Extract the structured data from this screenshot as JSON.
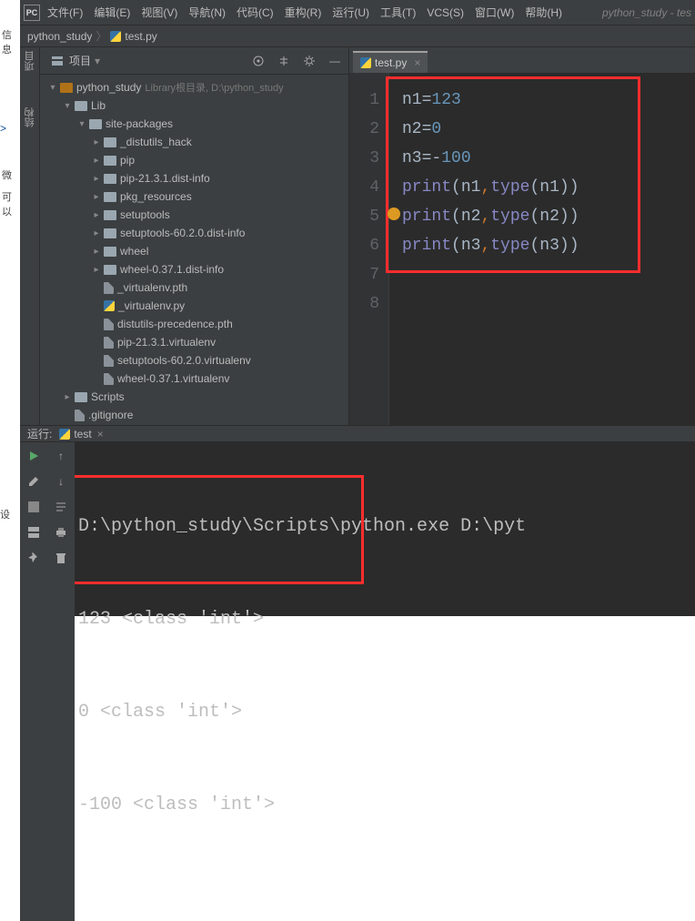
{
  "window": {
    "title_right": "python_study - tes"
  },
  "menu": {
    "logo": "PC",
    "items": [
      "文件(F)",
      "编辑(E)",
      "视图(V)",
      "导航(N)",
      "代码(C)",
      "重构(R)",
      "运行(U)",
      "工具(T)",
      "VCS(S)",
      "窗口(W)",
      "帮助(H)"
    ]
  },
  "crumbs": {
    "root": "python_study",
    "file": "test.py"
  },
  "left_edge": {
    "label1": "项目",
    "label2": "结构"
  },
  "project": {
    "panel_title": "项目",
    "tree": [
      {
        "d": 0,
        "tw": "▾",
        "ico": "dir-root",
        "text": "python_study",
        "hint": "Library根目录, D:\\python_study"
      },
      {
        "d": 1,
        "tw": "▾",
        "ico": "dir",
        "text": "Lib"
      },
      {
        "d": 2,
        "tw": "▾",
        "ico": "dir",
        "text": "site-packages"
      },
      {
        "d": 3,
        "tw": "▸",
        "ico": "dir",
        "text": "_distutils_hack"
      },
      {
        "d": 3,
        "tw": "▸",
        "ico": "dir",
        "text": "pip"
      },
      {
        "d": 3,
        "tw": "▸",
        "ico": "dir",
        "text": "pip-21.3.1.dist-info"
      },
      {
        "d": 3,
        "tw": "▸",
        "ico": "dir",
        "text": "pkg_resources"
      },
      {
        "d": 3,
        "tw": "▸",
        "ico": "dir",
        "text": "setuptools"
      },
      {
        "d": 3,
        "tw": "▸",
        "ico": "dir",
        "text": "setuptools-60.2.0.dist-info"
      },
      {
        "d": 3,
        "tw": "▸",
        "ico": "dir",
        "text": "wheel"
      },
      {
        "d": 3,
        "tw": "▸",
        "ico": "dir",
        "text": "wheel-0.37.1.dist-info"
      },
      {
        "d": 3,
        "tw": "",
        "ico": "file",
        "text": "_virtualenv.pth"
      },
      {
        "d": 3,
        "tw": "",
        "ico": "py",
        "text": "_virtualenv.py"
      },
      {
        "d": 3,
        "tw": "",
        "ico": "file",
        "text": "distutils-precedence.pth"
      },
      {
        "d": 3,
        "tw": "",
        "ico": "file",
        "text": "pip-21.3.1.virtualenv"
      },
      {
        "d": 3,
        "tw": "",
        "ico": "file",
        "text": "setuptools-60.2.0.virtualenv"
      },
      {
        "d": 3,
        "tw": "",
        "ico": "file",
        "text": "wheel-0.37.1.virtualenv"
      },
      {
        "d": 1,
        "tw": "▸",
        "ico": "dir",
        "text": "Scripts"
      },
      {
        "d": 1,
        "tw": "",
        "ico": "file",
        "text": ".gitignore"
      }
    ]
  },
  "editor": {
    "tab": "test.py",
    "line_numbers": [
      "1",
      "2",
      "3",
      "4",
      "5",
      "6",
      "7",
      "8"
    ],
    "code": [
      [
        [
          "def",
          "n1"
        ],
        [
          "op",
          "="
        ],
        [
          "num",
          "123"
        ]
      ],
      [
        [
          "def",
          "n2"
        ],
        [
          "op",
          "="
        ],
        [
          "num",
          "0"
        ]
      ],
      [
        [
          "def",
          "n3"
        ],
        [
          "op",
          "="
        ],
        [
          "op",
          "-"
        ],
        [
          "num",
          "100"
        ]
      ],
      [
        [
          "fn",
          "print"
        ],
        [
          "par",
          "("
        ],
        [
          "def",
          "n1"
        ],
        [
          "com",
          ","
        ],
        [
          "bi",
          "type"
        ],
        [
          "par",
          "("
        ],
        [
          "def",
          "n1"
        ],
        [
          "par",
          "))"
        ]
      ],
      [
        [
          "fn",
          "print"
        ],
        [
          "par",
          "("
        ],
        [
          "def",
          "n2"
        ],
        [
          "com",
          ","
        ],
        [
          "bi",
          "type"
        ],
        [
          "par",
          "("
        ],
        [
          "def",
          "n2"
        ],
        [
          "par",
          "))"
        ]
      ],
      [
        [
          "fn",
          "print"
        ],
        [
          "par",
          "("
        ],
        [
          "def",
          "n3"
        ],
        [
          "com",
          ","
        ],
        [
          "bi",
          "type"
        ],
        [
          "par",
          "("
        ],
        [
          "def",
          "n3"
        ],
        [
          "par",
          "))"
        ]
      ],
      [],
      []
    ]
  },
  "run": {
    "label": "运行:",
    "config": "test",
    "cmd_line": "D:\\python_study\\Scripts\\python.exe D:\\pyt",
    "output": [
      "123 <class 'int'>",
      "0 <class 'int'>",
      "-100 <class 'int'>"
    ]
  },
  "left_margin": {
    "a": "信息",
    "b": ">",
    "c": "微",
    "d": "可 以",
    "e": "设"
  }
}
